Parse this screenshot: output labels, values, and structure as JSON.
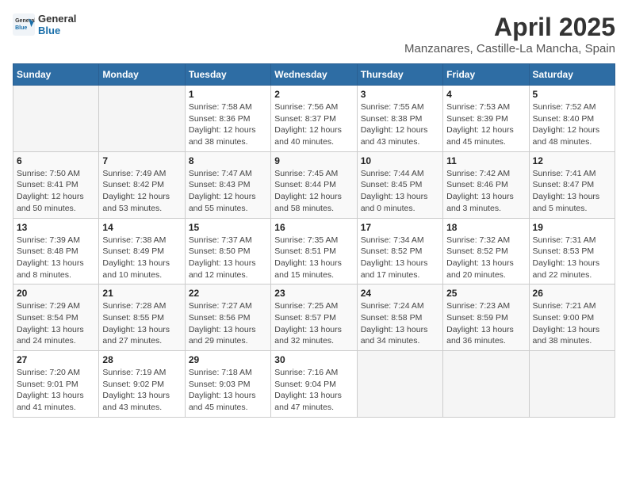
{
  "header": {
    "logo_general": "General",
    "logo_blue": "Blue",
    "title": "April 2025",
    "subtitle": "Manzanares, Castille-La Mancha, Spain"
  },
  "weekdays": [
    "Sunday",
    "Monday",
    "Tuesday",
    "Wednesday",
    "Thursday",
    "Friday",
    "Saturday"
  ],
  "weeks": [
    [
      {
        "day": "",
        "sunrise": "",
        "sunset": "",
        "daylight": ""
      },
      {
        "day": "",
        "sunrise": "",
        "sunset": "",
        "daylight": ""
      },
      {
        "day": "1",
        "sunrise": "Sunrise: 7:58 AM",
        "sunset": "Sunset: 8:36 PM",
        "daylight": "Daylight: 12 hours and 38 minutes."
      },
      {
        "day": "2",
        "sunrise": "Sunrise: 7:56 AM",
        "sunset": "Sunset: 8:37 PM",
        "daylight": "Daylight: 12 hours and 40 minutes."
      },
      {
        "day": "3",
        "sunrise": "Sunrise: 7:55 AM",
        "sunset": "Sunset: 8:38 PM",
        "daylight": "Daylight: 12 hours and 43 minutes."
      },
      {
        "day": "4",
        "sunrise": "Sunrise: 7:53 AM",
        "sunset": "Sunset: 8:39 PM",
        "daylight": "Daylight: 12 hours and 45 minutes."
      },
      {
        "day": "5",
        "sunrise": "Sunrise: 7:52 AM",
        "sunset": "Sunset: 8:40 PM",
        "daylight": "Daylight: 12 hours and 48 minutes."
      }
    ],
    [
      {
        "day": "6",
        "sunrise": "Sunrise: 7:50 AM",
        "sunset": "Sunset: 8:41 PM",
        "daylight": "Daylight: 12 hours and 50 minutes."
      },
      {
        "day": "7",
        "sunrise": "Sunrise: 7:49 AM",
        "sunset": "Sunset: 8:42 PM",
        "daylight": "Daylight: 12 hours and 53 minutes."
      },
      {
        "day": "8",
        "sunrise": "Sunrise: 7:47 AM",
        "sunset": "Sunset: 8:43 PM",
        "daylight": "Daylight: 12 hours and 55 minutes."
      },
      {
        "day": "9",
        "sunrise": "Sunrise: 7:45 AM",
        "sunset": "Sunset: 8:44 PM",
        "daylight": "Daylight: 12 hours and 58 minutes."
      },
      {
        "day": "10",
        "sunrise": "Sunrise: 7:44 AM",
        "sunset": "Sunset: 8:45 PM",
        "daylight": "Daylight: 13 hours and 0 minutes."
      },
      {
        "day": "11",
        "sunrise": "Sunrise: 7:42 AM",
        "sunset": "Sunset: 8:46 PM",
        "daylight": "Daylight: 13 hours and 3 minutes."
      },
      {
        "day": "12",
        "sunrise": "Sunrise: 7:41 AM",
        "sunset": "Sunset: 8:47 PM",
        "daylight": "Daylight: 13 hours and 5 minutes."
      }
    ],
    [
      {
        "day": "13",
        "sunrise": "Sunrise: 7:39 AM",
        "sunset": "Sunset: 8:48 PM",
        "daylight": "Daylight: 13 hours and 8 minutes."
      },
      {
        "day": "14",
        "sunrise": "Sunrise: 7:38 AM",
        "sunset": "Sunset: 8:49 PM",
        "daylight": "Daylight: 13 hours and 10 minutes."
      },
      {
        "day": "15",
        "sunrise": "Sunrise: 7:37 AM",
        "sunset": "Sunset: 8:50 PM",
        "daylight": "Daylight: 13 hours and 12 minutes."
      },
      {
        "day": "16",
        "sunrise": "Sunrise: 7:35 AM",
        "sunset": "Sunset: 8:51 PM",
        "daylight": "Daylight: 13 hours and 15 minutes."
      },
      {
        "day": "17",
        "sunrise": "Sunrise: 7:34 AM",
        "sunset": "Sunset: 8:52 PM",
        "daylight": "Daylight: 13 hours and 17 minutes."
      },
      {
        "day": "18",
        "sunrise": "Sunrise: 7:32 AM",
        "sunset": "Sunset: 8:52 PM",
        "daylight": "Daylight: 13 hours and 20 minutes."
      },
      {
        "day": "19",
        "sunrise": "Sunrise: 7:31 AM",
        "sunset": "Sunset: 8:53 PM",
        "daylight": "Daylight: 13 hours and 22 minutes."
      }
    ],
    [
      {
        "day": "20",
        "sunrise": "Sunrise: 7:29 AM",
        "sunset": "Sunset: 8:54 PM",
        "daylight": "Daylight: 13 hours and 24 minutes."
      },
      {
        "day": "21",
        "sunrise": "Sunrise: 7:28 AM",
        "sunset": "Sunset: 8:55 PM",
        "daylight": "Daylight: 13 hours and 27 minutes."
      },
      {
        "day": "22",
        "sunrise": "Sunrise: 7:27 AM",
        "sunset": "Sunset: 8:56 PM",
        "daylight": "Daylight: 13 hours and 29 minutes."
      },
      {
        "day": "23",
        "sunrise": "Sunrise: 7:25 AM",
        "sunset": "Sunset: 8:57 PM",
        "daylight": "Daylight: 13 hours and 32 minutes."
      },
      {
        "day": "24",
        "sunrise": "Sunrise: 7:24 AM",
        "sunset": "Sunset: 8:58 PM",
        "daylight": "Daylight: 13 hours and 34 minutes."
      },
      {
        "day": "25",
        "sunrise": "Sunrise: 7:23 AM",
        "sunset": "Sunset: 8:59 PM",
        "daylight": "Daylight: 13 hours and 36 minutes."
      },
      {
        "day": "26",
        "sunrise": "Sunrise: 7:21 AM",
        "sunset": "Sunset: 9:00 PM",
        "daylight": "Daylight: 13 hours and 38 minutes."
      }
    ],
    [
      {
        "day": "27",
        "sunrise": "Sunrise: 7:20 AM",
        "sunset": "Sunset: 9:01 PM",
        "daylight": "Daylight: 13 hours and 41 minutes."
      },
      {
        "day": "28",
        "sunrise": "Sunrise: 7:19 AM",
        "sunset": "Sunset: 9:02 PM",
        "daylight": "Daylight: 13 hours and 43 minutes."
      },
      {
        "day": "29",
        "sunrise": "Sunrise: 7:18 AM",
        "sunset": "Sunset: 9:03 PM",
        "daylight": "Daylight: 13 hours and 45 minutes."
      },
      {
        "day": "30",
        "sunrise": "Sunrise: 7:16 AM",
        "sunset": "Sunset: 9:04 PM",
        "daylight": "Daylight: 13 hours and 47 minutes."
      },
      {
        "day": "",
        "sunrise": "",
        "sunset": "",
        "daylight": ""
      },
      {
        "day": "",
        "sunrise": "",
        "sunset": "",
        "daylight": ""
      },
      {
        "day": "",
        "sunrise": "",
        "sunset": "",
        "daylight": ""
      }
    ]
  ]
}
